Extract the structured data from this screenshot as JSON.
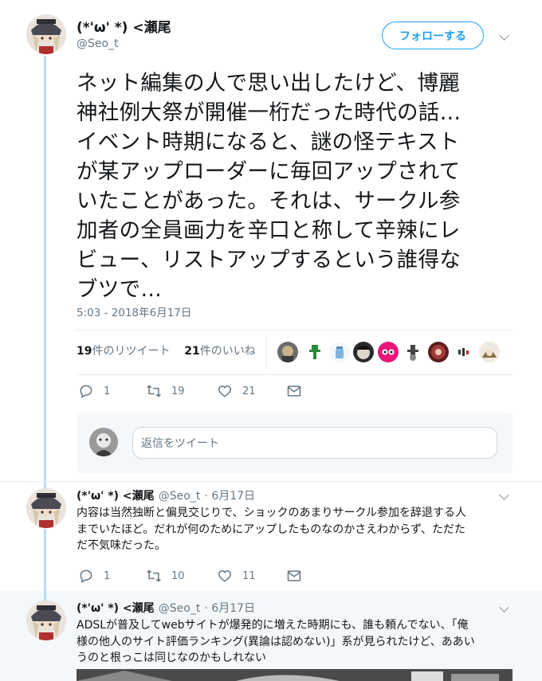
{
  "main_tweet": {
    "author_name": "(*'ω' *) <瀬尾",
    "author_handle": "@Seo_t",
    "follow_label": "フォローする",
    "text_lines": [
      "ネット編集の人で思い出したけど、博麗",
      "神社例大祭が開催一桁だった時代の話…",
      "イベント時期になると、謎の怪テキスト",
      "が某アップローダーに毎回アップされて",
      "いたことがあった。それは、サークル参",
      "加者の全員画力を辛口と称して辛辣にレ",
      "ビュー、リストアップするという誰得な",
      "ブツで…"
    ],
    "timestamp": "5:03 - 2018年6月17日",
    "retweet_count": "19",
    "retweet_label": "件のリツイート",
    "like_count": "21",
    "like_label": "件のいいね",
    "actions": {
      "reply": "1",
      "retweet": "19",
      "like": "21"
    }
  },
  "reply_box": {
    "placeholder": "返信をツイート"
  },
  "replies": [
    {
      "author_name": "(*'ω' *) <瀬尾",
      "author_handle": "@Seo_t",
      "date": "· 6月17日",
      "text_lines": [
        "内容は当然独断と偏見交じりで、ショックのあまりサークル参加を辞退する人",
        "までいたほど。だれが何のためにアップしたものなのかさえわからず、ただた",
        "だ不気味だった。"
      ],
      "actions": {
        "reply": "1",
        "retweet": "10",
        "like": "11"
      }
    },
    {
      "author_name": "(*'ω' *) <瀬尾",
      "author_handle": "@Seo_t",
      "date": "· 6月17日",
      "text_lines": [
        "ADSLが普及してwebサイトが爆発的に増えた時期にも、誰も頼んでない、「俺",
        "様の他人のサイト評価ランキング(異論は認めない)」系が見られたけど、ああい",
        "うのと根っこは同じなのかもしれない"
      ]
    }
  ],
  "colors": {
    "accent": "#1da1f2",
    "muted": "#657786",
    "thread_line": "#b7dbf5",
    "divider": "#e6ecf0"
  },
  "icons": [
    "reply-icon",
    "retweet-icon",
    "like-icon",
    "message-icon",
    "chevron-down-icon"
  ]
}
